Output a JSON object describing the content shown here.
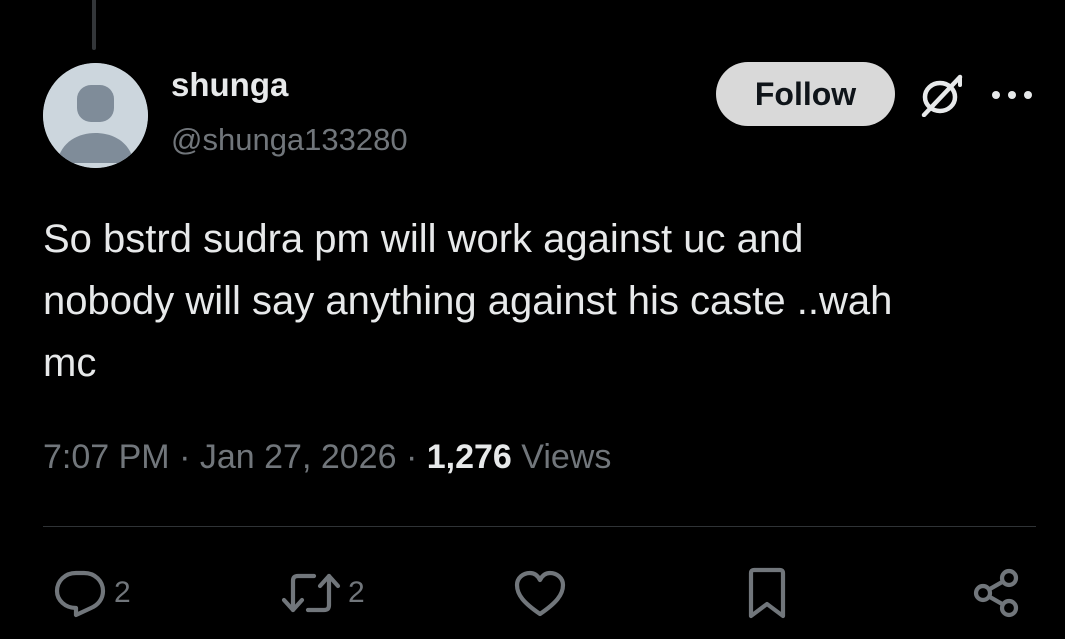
{
  "author": {
    "name": "shunga",
    "handle": "@shunga133280"
  },
  "header": {
    "follow_label": "Follow",
    "grok_icon": "grok-icon",
    "more_icon": "more-horizontal-icon"
  },
  "tweet": {
    "text": "So bstrd sudra pm will work against uc and\nnobody will say anything against his caste ..wah\nmc",
    "time": "7:07 PM",
    "date": "Jan 27, 2026",
    "separator": "·",
    "views_count": "1,276",
    "views_label": "Views"
  },
  "actions": {
    "reply_count": "2",
    "retweet_count": "2",
    "icons": [
      "reply-icon",
      "retweet-icon",
      "like-icon",
      "bookmark-icon",
      "share-icon"
    ]
  },
  "colors": {
    "background": "#000000",
    "primary_text": "#e7e9ea",
    "secondary_text": "#71767b",
    "follow_button_bg": "#d9d9d9",
    "divider": "#2f3336",
    "avatar_bg": "#ccd6dd",
    "avatar_figure": "#7f8c99"
  }
}
